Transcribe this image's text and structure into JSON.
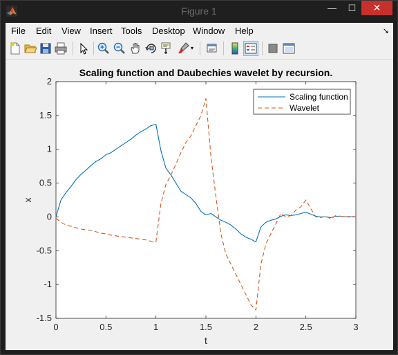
{
  "window": {
    "title": "Figure 1",
    "minimize": "—",
    "maximize": "☐",
    "close": "✕"
  },
  "menu": [
    "File",
    "Edit",
    "View",
    "Insert",
    "Tools",
    "Desktop",
    "Window",
    "Help"
  ],
  "toolbar": [
    "new-figure-icon",
    "open-file-icon",
    "save-icon",
    "print-icon",
    "edit-plot-arrow-icon",
    "zoom-in-icon",
    "zoom-out-icon",
    "pan-hand-icon",
    "rotate-3d-icon",
    "data-cursor-icon",
    "brush-icon",
    "link-plot-icon",
    "insert-colorbar-icon",
    "insert-legend-icon",
    "hide-plot-tools-icon",
    "show-plot-tools-icon"
  ],
  "colors": {
    "scaling": "#0072BD",
    "wavelet": "#D95319",
    "close_button": "#c7302b"
  },
  "chart_data": {
    "type": "line",
    "title": "Scaling function and Daubechies wavelet by recursion.",
    "xlabel": "t",
    "ylabel": "x",
    "xlim": [
      0,
      3
    ],
    "ylim": [
      -1.5,
      2
    ],
    "xticks": [
      "0",
      "0.5",
      "1",
      "1.5",
      "2",
      "2.5",
      "3"
    ],
    "yticks": [
      "-1.5",
      "-1",
      "-0.5",
      "0",
      "0.5",
      "1",
      "1.5",
      "2"
    ],
    "grid": false,
    "legend": "top-right",
    "series": [
      {
        "name": "Scaling function",
        "style": "solid",
        "x": [
          0,
          0.05,
          0.1,
          0.15,
          0.2,
          0.25,
          0.3,
          0.35,
          0.4,
          0.45,
          0.5,
          0.55,
          0.6,
          0.65,
          0.7,
          0.75,
          0.8,
          0.85,
          0.9,
          0.95,
          1.0,
          1.05,
          1.1,
          1.15,
          1.2,
          1.25,
          1.3,
          1.35,
          1.4,
          1.45,
          1.5,
          1.55,
          1.6,
          1.65,
          1.7,
          1.75,
          1.8,
          1.85,
          1.9,
          1.95,
          2.0,
          2.05,
          2.1,
          2.15,
          2.2,
          2.25,
          2.3,
          2.35,
          2.4,
          2.45,
          2.5,
          2.55,
          2.6,
          2.65,
          2.7,
          2.75,
          2.8,
          2.85,
          2.9,
          2.95,
          3.0
        ],
        "y": [
          0.0,
          0.25,
          0.36,
          0.45,
          0.55,
          0.63,
          0.69,
          0.76,
          0.82,
          0.86,
          0.92,
          0.95,
          1.0,
          1.05,
          1.1,
          1.15,
          1.21,
          1.26,
          1.3,
          1.35,
          1.37,
          0.98,
          0.72,
          0.62,
          0.5,
          0.38,
          0.33,
          0.28,
          0.2,
          0.08,
          0.03,
          0.05,
          0.0,
          -0.05,
          -0.08,
          -0.12,
          -0.18,
          -0.25,
          -0.3,
          -0.33,
          -0.37,
          -0.15,
          -0.08,
          -0.05,
          -0.03,
          0.01,
          0.03,
          0.02,
          0.03,
          0.05,
          0.07,
          0.04,
          0.01,
          0.0,
          0.0,
          -0.01,
          0.01,
          0.01,
          0.0,
          0.0,
          0.0
        ]
      },
      {
        "name": "Wavelet",
        "style": "dashed",
        "x": [
          0,
          0.05,
          0.1,
          0.15,
          0.2,
          0.25,
          0.3,
          0.35,
          0.4,
          0.45,
          0.5,
          0.55,
          0.6,
          0.65,
          0.7,
          0.75,
          0.8,
          0.85,
          0.9,
          0.95,
          1.0,
          1.05,
          1.1,
          1.15,
          1.2,
          1.25,
          1.3,
          1.35,
          1.4,
          1.45,
          1.5,
          1.55,
          1.6,
          1.65,
          1.7,
          1.75,
          1.8,
          1.85,
          1.9,
          1.95,
          2.0,
          2.05,
          2.1,
          2.15,
          2.2,
          2.25,
          2.3,
          2.35,
          2.4,
          2.45,
          2.5,
          2.55,
          2.6,
          2.65,
          2.7,
          2.75,
          2.8,
          2.85,
          2.9,
          2.95,
          3.0
        ],
        "y": [
          -0.02,
          -0.08,
          -0.12,
          -0.14,
          -0.16,
          -0.18,
          -0.19,
          -0.2,
          -0.22,
          -0.24,
          -0.25,
          -0.27,
          -0.28,
          -0.29,
          -0.3,
          -0.31,
          -0.32,
          -0.33,
          -0.34,
          -0.36,
          -0.37,
          0.2,
          0.48,
          0.62,
          0.78,
          0.95,
          1.1,
          1.2,
          1.35,
          1.5,
          1.75,
          0.9,
          0.3,
          -0.25,
          -0.55,
          -0.7,
          -0.85,
          -1.0,
          -1.15,
          -1.3,
          -1.38,
          -0.7,
          -0.4,
          -0.25,
          -0.1,
          0.05,
          0.0,
          0.02,
          0.1,
          0.15,
          0.25,
          0.12,
          0.0,
          -0.01,
          0.01,
          -0.03,
          0.02,
          0.01,
          0.0,
          0.01,
          0.0
        ]
      }
    ]
  }
}
